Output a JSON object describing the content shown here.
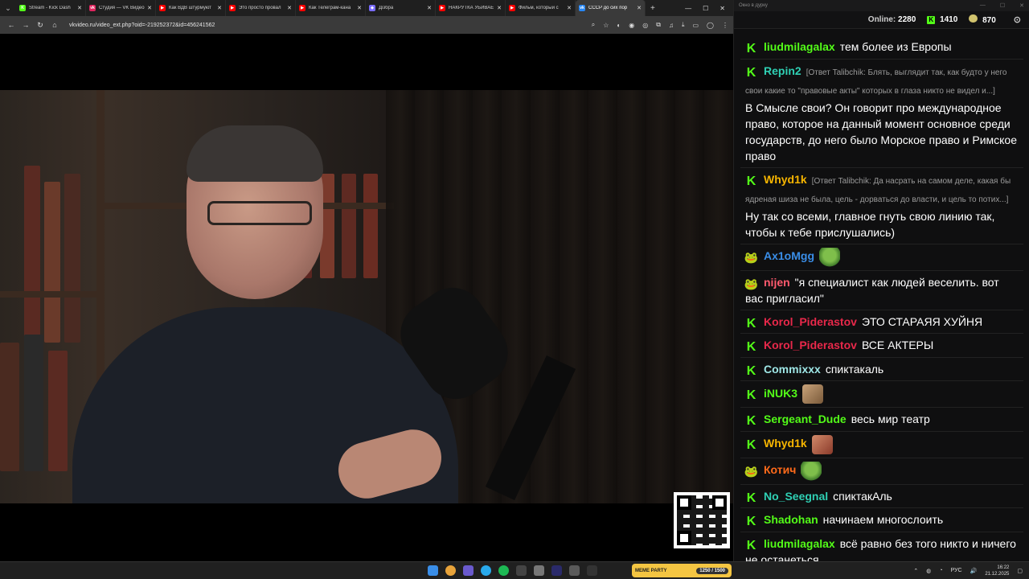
{
  "browser": {
    "tabs": [
      {
        "title": "Stream - Kick Dash",
        "fav": "K",
        "color": "#53fc18"
      },
      {
        "title": "Студия — VK Видео",
        "fav": "vk",
        "color": "#e0245e"
      },
      {
        "title": "Как ВДВ штурмуют",
        "fav": "▶",
        "color": "#ff0000"
      },
      {
        "title": "Это просто провал",
        "fav": "▶",
        "color": "#ff0000"
      },
      {
        "title": "Как Телеграм-кана",
        "fav": "▶",
        "color": "#ff0000"
      },
      {
        "title": "Дізбра",
        "fav": "◈",
        "color": "#7a6cff"
      },
      {
        "title": "НАКРУТКА УБИВАЕ",
        "fav": "▶",
        "color": "#ff0000"
      },
      {
        "title": "Фильм, который с",
        "fav": "▶",
        "color": "#ff0000"
      },
      {
        "title": "СССР до сих пор",
        "fav": "vk",
        "color": "#2787f5",
        "active": true
      }
    ],
    "url": "vkvideo.ru/video_ext.php?oid=-219252372&id=456241562"
  },
  "chat": {
    "window_title": "Окно в дурку",
    "online_label": "Online:",
    "online_value": "2280",
    "kick_count": "1410",
    "frog_count": "870",
    "messages": [
      {
        "user": "liudmilagalax",
        "color": "#53fc18",
        "badge": "K",
        "text": "тем более из Европы"
      },
      {
        "user": "Repin2",
        "color": "#2fd0b4",
        "badge": "K",
        "reply": "[Ответ Talibchik: Блять, выглядит так, как будто у него свои какие то \"правовые акты\" которых в глаза никто не видел и...]",
        "text": "В Смысле свои? Он говорит про международное право, которое на данный момент основное среди государств, до него было Морское право и Римское право"
      },
      {
        "user": "Whyd1k",
        "color": "#f7b500",
        "badge": "K",
        "reply": "[Ответ Talibchik: Да насрать на самом деле, какая бы ядреная шиза не была, цель - дорваться до власти, и цель то потих...]",
        "text": "Ну так со всеми, главное гнуть свою линию так, чтобы к тебе прислушались)"
      },
      {
        "user": "Ax1oMgg",
        "color": "#3a8ee8",
        "badge": "frog",
        "emote": "pepe",
        "text": ""
      },
      {
        "user": "nijen",
        "color": "#ff5a6e",
        "badge": "frog",
        "text": "\"я специалист как людей веселить. вот вас пригласил\""
      },
      {
        "user": "Korol_Piderastov",
        "color": "#e8284a",
        "badge": "K",
        "text": "ЭТО СТАРАЯЯ ХУЙНЯ"
      },
      {
        "user": "Korol_Piderastov",
        "color": "#e8284a",
        "badge": "K",
        "text": "ВСЕ АКТЕРЫ"
      },
      {
        "user": "Commixxx",
        "color": "#9ee6e6",
        "badge": "K",
        "text": "спиктакаль"
      },
      {
        "user": "iNUK3",
        "color": "#53fc18",
        "badge": "K",
        "emote": "cat",
        "text": ""
      },
      {
        "user": "Sergeant_Dude",
        "color": "#53fc18",
        "badge": "K",
        "text": "весь мир театр"
      },
      {
        "user": "Whyd1k",
        "color": "#f7b500",
        "badge": "K",
        "emote": "man",
        "text": ""
      },
      {
        "user": "Котич",
        "color": "#ff6a1a",
        "badge": "frog",
        "emote": "pepe",
        "text": ""
      },
      {
        "user": "No_Seegnal",
        "color": "#2fd0b4",
        "badge": "K",
        "text": "спиктакАль"
      },
      {
        "user": "Shadohan",
        "color": "#53fc18",
        "badge": "K",
        "text": "начинаем многослоить"
      },
      {
        "user": "liudmilagalax",
        "color": "#53fc18",
        "badge": "K",
        "text": "всё равно без того никто и ничего не останеться"
      }
    ]
  },
  "taskbar": {
    "meme_widget": "MEME PARTY",
    "meme_progress": "1250 / 1500",
    "lang": "РУС",
    "time": "16:22",
    "date": "21.12.2025"
  }
}
